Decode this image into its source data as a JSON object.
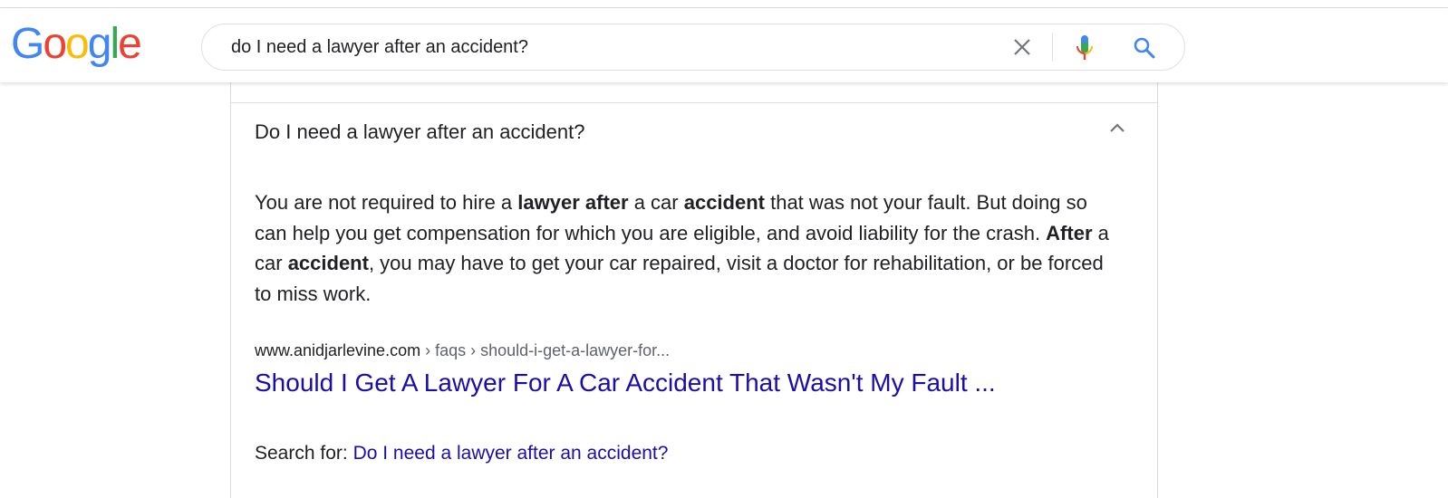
{
  "header": {
    "logo": [
      "G",
      "o",
      "o",
      "g",
      "l",
      "e"
    ],
    "logo_colors": [
      "#4285F4",
      "#EA4335",
      "#FBBC05",
      "#4285F4",
      "#34A853",
      "#EA4335"
    ],
    "search_value": "do I need a lawyer after an accident?"
  },
  "paa": {
    "question": "Do I need a lawyer after an accident?",
    "answer_segments": [
      {
        "text": "You are not required to hire a ",
        "bold": false
      },
      {
        "text": "lawyer after",
        "bold": true
      },
      {
        "text": " a car ",
        "bold": false
      },
      {
        "text": "accident",
        "bold": true
      },
      {
        "text": " that was not your fault. But doing so can help you get compensation for which you are eligible, and avoid liability for the crash. ",
        "bold": false
      },
      {
        "text": "After",
        "bold": true
      },
      {
        "text": " a car ",
        "bold": false
      },
      {
        "text": "accident",
        "bold": true
      },
      {
        "text": ", you may have to get your car repaired, visit a doctor for rehabilitation, or be forced to miss work.",
        "bold": false
      }
    ],
    "cite_domain": "www.anidjarlevine.com",
    "cite_path": " › faqs › should-i-get-a-lawyer-for...",
    "result_title": "Should I Get A Lawyer For A Car Accident That Wasn't My Fault ...",
    "search_for_label": "Search for: ",
    "search_for_link": "Do I need a lawyer after an accident?"
  },
  "colors": {
    "link": "#1a0dab",
    "border": "#dadce0",
    "icon_gray": "#70757a",
    "search_blue": "#4285F4"
  },
  "icons": {
    "clear": "close-icon",
    "mic": "microphone-icon",
    "search": "search-icon",
    "collapse": "chevron-up-icon"
  }
}
